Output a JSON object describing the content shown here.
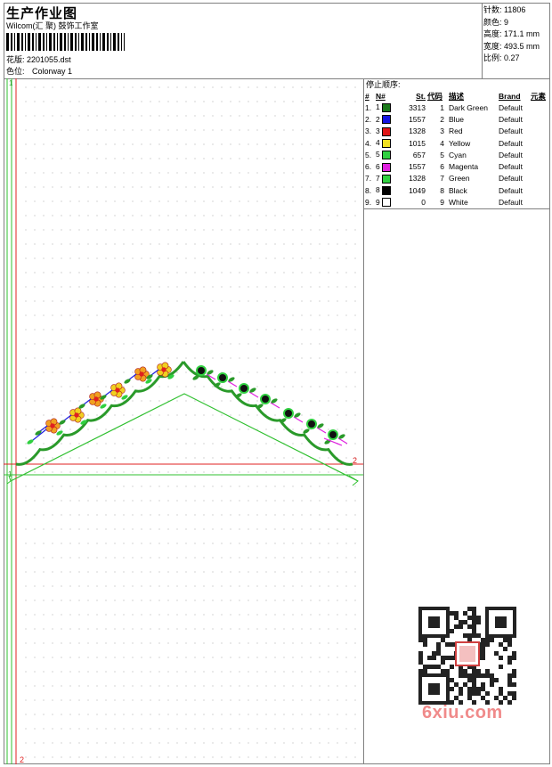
{
  "header": {
    "title": "生产作业图",
    "company": "Wilcom(汇 聚) 鼓饰工作室",
    "design_label": "花版:",
    "design_file": "2201055.dst",
    "color_label": "色位:",
    "colorway": "Colorway 1"
  },
  "stats": [
    {
      "label": "针数:",
      "value": "11806"
    },
    {
      "label": "颜色:",
      "value": "9"
    },
    {
      "label": "高度:",
      "value": "171.1 mm"
    },
    {
      "label": "宽度:",
      "value": "493.5 mm"
    },
    {
      "label": "比例:",
      "value": "0.27"
    }
  ],
  "sequence": {
    "title": "停止顺序:",
    "headers": [
      "#",
      "N#",
      "St.",
      "代码",
      "描述",
      "Brand",
      "元素"
    ],
    "rows": [
      {
        "idx": "1.",
        "n": "1",
        "color": "#1a7a1a",
        "st": "3313",
        "code": "1",
        "desc": "Dark Green",
        "brand": "Default"
      },
      {
        "idx": "2.",
        "n": "2",
        "color": "#1515e0",
        "st": "1557",
        "code": "2",
        "desc": "Blue",
        "brand": "Default"
      },
      {
        "idx": "3.",
        "n": "3",
        "color": "#e01515",
        "st": "1328",
        "code": "3",
        "desc": "Red",
        "brand": "Default"
      },
      {
        "idx": "4.",
        "n": "4",
        "color": "#f0e020",
        "st": "1015",
        "code": "4",
        "desc": "Yellow",
        "brand": "Default"
      },
      {
        "idx": "5.",
        "n": "5",
        "color": "#30d040",
        "st": "657",
        "code": "5",
        "desc": "Cyan",
        "brand": "Default"
      },
      {
        "idx": "6.",
        "n": "6",
        "color": "#e020e0",
        "st": "1557",
        "code": "6",
        "desc": "Magenta",
        "brand": "Default"
      },
      {
        "idx": "7.",
        "n": "7",
        "color": "#30d040",
        "st": "1328",
        "code": "7",
        "desc": "Green",
        "brand": "Default"
      },
      {
        "idx": "8.",
        "n": "8",
        "color": "#000000",
        "st": "1049",
        "code": "8",
        "desc": "Black",
        "brand": "Default"
      },
      {
        "idx": "9.",
        "n": "9",
        "color": "#ffffff",
        "st": "0",
        "code": "9",
        "desc": "White",
        "brand": "Default"
      }
    ]
  },
  "canvas": {
    "marker_top_left": "1",
    "marker_right": "2",
    "marker_bottom": "2",
    "marker_left": "1"
  },
  "watermark": "6xiu.com"
}
